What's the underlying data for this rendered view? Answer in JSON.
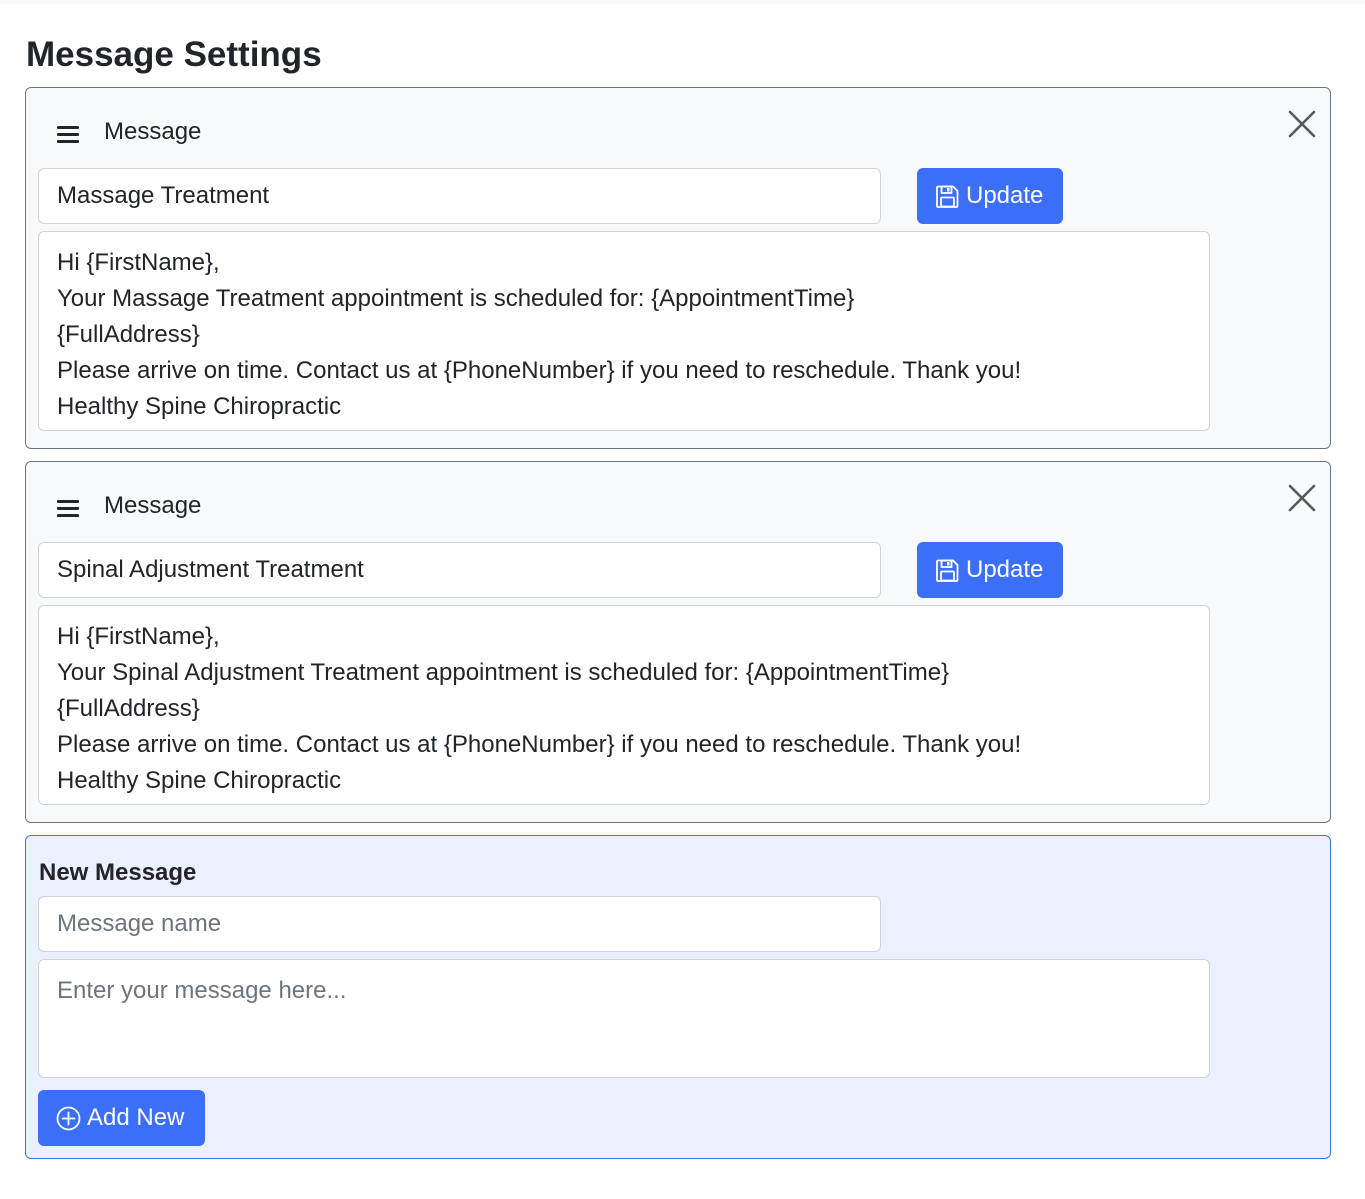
{
  "page": {
    "title": "Message Settings"
  },
  "messages": [
    {
      "header_label": "Message",
      "name": "Massage Treatment",
      "body": "Hi {FirstName},\nYour Massage Treatment appointment is scheduled for: {AppointmentTime}\n{FullAddress}\nPlease arrive on time. Contact us at {PhoneNumber} if you need to reschedule. Thank you!\nHealthy Spine Chiropractic",
      "update_label": "Update"
    },
    {
      "header_label": "Message",
      "name": "Spinal Adjustment Treatment",
      "body": "Hi {FirstName},\nYour Spinal Adjustment Treatment appointment is scheduled for: {AppointmentTime}\n{FullAddress}\nPlease arrive on time. Contact us at {PhoneNumber} if you need to reschedule. Thank you!\nHealthy Spine Chiropractic",
      "update_label": "Update"
    }
  ],
  "new_message": {
    "title": "New Message",
    "name_placeholder": "Message name",
    "body_placeholder": "Enter your message here...",
    "add_label": "Add New"
  },
  "icons": {
    "drag": "hamburger-drag-icon",
    "close": "close-x-icon",
    "save": "floppy-disk-icon",
    "add": "plus-circle-icon"
  },
  "colors": {
    "primary": "#3c6ff8",
    "card_bg": "#f8f9fa",
    "new_card_bg": "#ebf0fe",
    "new_card_border": "#3d73e6",
    "text": "#212529",
    "placeholder": "#6c757d"
  }
}
